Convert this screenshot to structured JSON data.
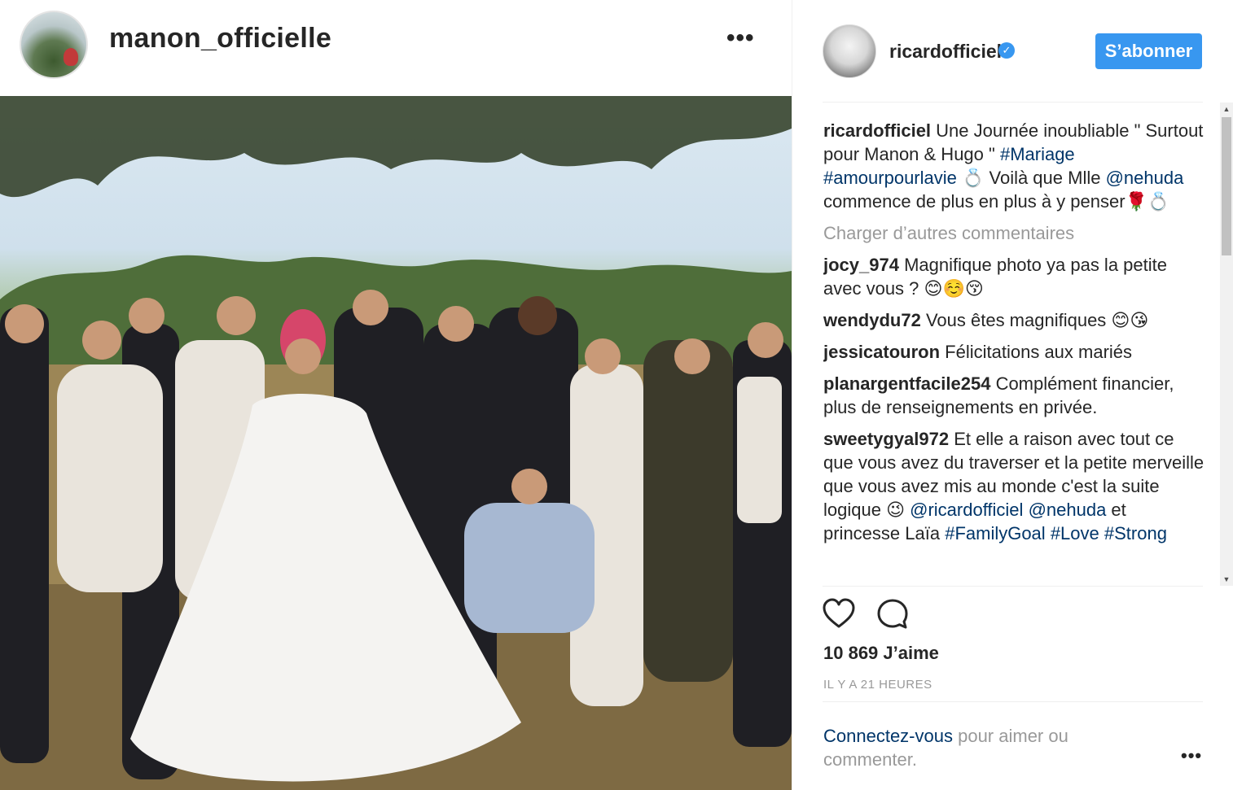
{
  "post_owner": {
    "username": "manon_officielle",
    "more_label": "•••"
  },
  "author": {
    "username": "ricardofficiel",
    "verified_glyph": "✓",
    "follow_label": "S’abonner"
  },
  "caption": {
    "user": "ricardofficiel",
    "text1": "Une Journée inoubliable \" Surtout pour Manon & Hugo \" ",
    "tag1": "#Mariage",
    "tag2": "#amourpourlavie",
    "text2": " 💍 Voilà que Mlle ",
    "mention": "@nehuda",
    "text3": " commence de plus en plus à y penser🌹💍"
  },
  "load_more": "Charger d’autres commentaires",
  "comments": [
    {
      "user": "jocy_974",
      "text": "Magnifique photo ya pas la petite avec vous ? 😊☺️😚"
    },
    {
      "user": "wendydu72",
      "text": "Vous êtes magnifiques 😊😘"
    },
    {
      "user": "jessicatouron",
      "text": "Félicitations aux mariés"
    },
    {
      "user": "planargentfacile254",
      "text": "Complément financier, plus de renseignements en privée."
    }
  ],
  "last_comment": {
    "user": "sweetygyal972",
    "text": "Et elle a raison avec tout ce que vous avez du traverser et la petite merveille que vous avez mis au monde c'est la suite logique 😉 ",
    "mention1": "@ricardofficiel",
    "mention2": "@nehuda",
    "text2": " et princesse Laïa ",
    "tag_a": "#FamilyGoal",
    "tag_b": "#Love",
    "tag_c": "#Strong"
  },
  "likes": "10 869 J’aime",
  "timestamp": "IL Y A 21 HEURES",
  "login": {
    "link": "Connectez-vous",
    "rest": " pour aimer ou commenter."
  },
  "bottom_more": "•••",
  "scrollbar": {
    "up": "▲",
    "down": "▼"
  },
  "colors": {
    "accent": "#3897f0",
    "link": "#003569",
    "muted": "#999999"
  }
}
